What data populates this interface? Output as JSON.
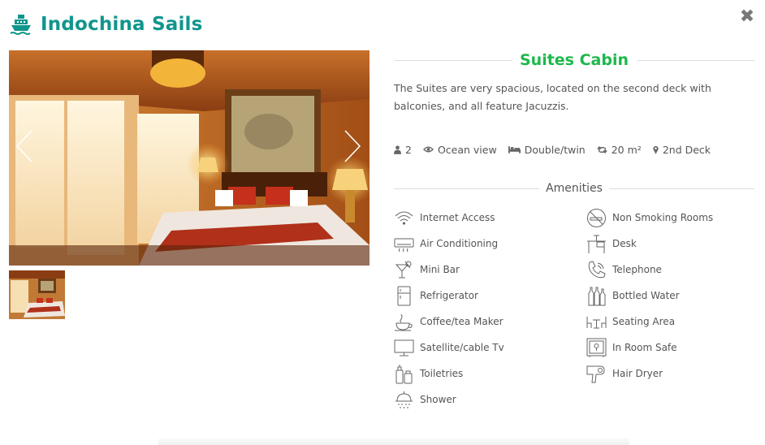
{
  "header": {
    "brand_name": "Indochina Sails",
    "brand_icon": "ship-icon",
    "close_icon": "close-icon",
    "close_symbol": "✖"
  },
  "gallery": {
    "prev_icon": "chevron-left-icon",
    "next_icon": "chevron-right-icon"
  },
  "cabin": {
    "title": "Suites Cabin",
    "description": "The Suites are very spacious, located on the second deck with balconies, and all feature Jacuzzis.",
    "specs": {
      "guests": "2",
      "view": "Ocean view",
      "bed": "Double/twin",
      "size": "20 m²",
      "deck": "2nd Deck"
    }
  },
  "amenities": {
    "title": "Amenities",
    "left": [
      {
        "label": "Internet Access",
        "icon": "wifi-icon"
      },
      {
        "label": "Air Conditioning",
        "icon": "air-conditioner-icon"
      },
      {
        "label": "Mini Bar",
        "icon": "cocktail-icon"
      },
      {
        "label": "Refrigerator",
        "icon": "refrigerator-icon"
      },
      {
        "label": "Coffee/tea Maker",
        "icon": "coffee-cup-icon"
      },
      {
        "label": "Satellite/cable Tv",
        "icon": "tv-icon"
      },
      {
        "label": "Toiletries",
        "icon": "toiletries-icon"
      },
      {
        "label": "Shower",
        "icon": "shower-icon"
      }
    ],
    "right": [
      {
        "label": "Non Smoking Rooms",
        "icon": "no-smoking-icon"
      },
      {
        "label": "Desk",
        "icon": "desk-icon"
      },
      {
        "label": "Telephone",
        "icon": "telephone-icon"
      },
      {
        "label": "Bottled Water",
        "icon": "bottles-icon"
      },
      {
        "label": "Seating Area",
        "icon": "seating-icon"
      },
      {
        "label": "In Room Safe",
        "icon": "safe-icon"
      },
      {
        "label": "Hair Dryer",
        "icon": "hair-dryer-icon"
      }
    ]
  },
  "colors": {
    "brand": "#10958c",
    "cabin_title": "#1cb84b"
  }
}
